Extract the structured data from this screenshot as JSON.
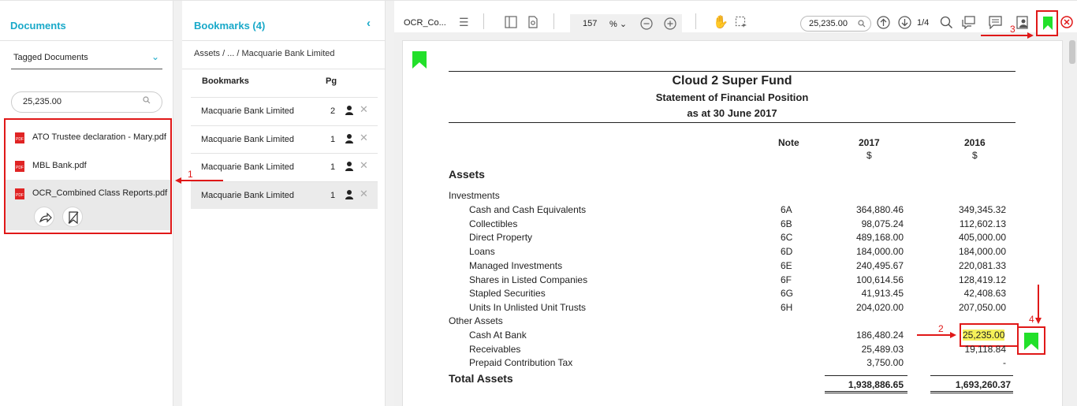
{
  "documents_panel": {
    "title": "Documents",
    "filter_value": "Tagged Documents",
    "search_value": "25,235.00",
    "files": [
      {
        "name": "ATO Trustee declaration - Mary.pdf"
      },
      {
        "name": "MBL Bank.pdf"
      },
      {
        "name": "OCR_Combined Class Reports.pdf"
      }
    ]
  },
  "bookmarks_panel": {
    "title": "Bookmarks (4)",
    "breadcrumb": "Assets / ... / Macquarie Bank Limited",
    "col_bookmarks": "Bookmarks",
    "col_pg": "Pg",
    "rows": [
      {
        "name": "Macquarie Bank Limited",
        "pg": "2"
      },
      {
        "name": "Macquarie Bank Limited",
        "pg": "1"
      },
      {
        "name": "Macquarie Bank Limited",
        "pg": "1"
      },
      {
        "name": "Macquarie Bank Limited",
        "pg": "1"
      }
    ]
  },
  "viewer": {
    "tab_name": "OCR_Co...",
    "zoom": "157",
    "zoom_unit": "%",
    "find_value": "25,235.00",
    "page_count": "1/4"
  },
  "document": {
    "title": "Cloud 2 Super Fund",
    "subtitle": "Statement of Financial Position",
    "date": "as at 30 June 2017",
    "col_note": "Note",
    "col_2017": "2017",
    "col_2016": "2016",
    "currency": "$",
    "section": "Assets",
    "investments_label": "Investments",
    "other_assets_label": "Other Assets",
    "total_label": "Total Assets",
    "total_2017": "1,938,886.65",
    "total_2016": "1,693,260.37",
    "rows": [
      {
        "label": "Cash and Cash Equivalents",
        "note": "6A",
        "v2017": "364,880.46",
        "v2016": "349,345.32"
      },
      {
        "label": "Collectibles",
        "note": "6B",
        "v2017": "98,075.24",
        "v2016": "112,602.13"
      },
      {
        "label": "Direct Property",
        "note": "6C",
        "v2017": "489,168.00",
        "v2016": "405,000.00"
      },
      {
        "label": "Loans",
        "note": "6D",
        "v2017": "184,000.00",
        "v2016": "184,000.00"
      },
      {
        "label": "Managed Investments",
        "note": "6E",
        "v2017": "240,495.67",
        "v2016": "220,081.33"
      },
      {
        "label": "Shares in Listed Companies",
        "note": "6F",
        "v2017": "100,614.56",
        "v2016": "128,419.12"
      },
      {
        "label": "Stapled Securities",
        "note": "6G",
        "v2017": "41,913.45",
        "v2016": "42,408.63"
      },
      {
        "label": "Units In Unlisted Unit Trusts",
        "note": "6H",
        "v2017": "204,020.00",
        "v2016": "207,050.00"
      }
    ],
    "other_rows": [
      {
        "label": "Cash At Bank",
        "v2017": "186,480.24",
        "v2016": "25,235.00"
      },
      {
        "label": "Receivables",
        "v2017": "25,489.03",
        "v2016": "19,118.84"
      },
      {
        "label": "Prepaid Contribution Tax",
        "v2017": "3,750.00",
        "v2016": "-"
      }
    ]
  },
  "annotations": {
    "a1": "1",
    "a2": "2",
    "a3": "3",
    "a4": "4"
  },
  "colors": {
    "accent": "#19a9c9",
    "bookmark_green": "#22e02a",
    "annotation_red": "#e01818",
    "highlight": "#f6f15a"
  }
}
